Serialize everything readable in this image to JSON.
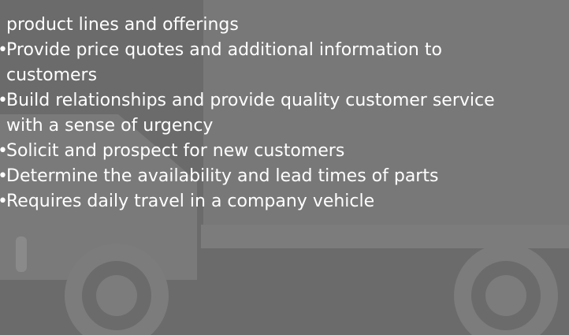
{
  "bullets": [
    {
      "lines": [
        "product lines and offerings"
      ],
      "continuation": true
    },
    {
      "lines": [
        "Provide price quotes and additional information to",
        "customers"
      ]
    },
    {
      "lines": [
        "Build relationships and provide quality customer service",
        "with a sense of urgency"
      ]
    },
    {
      "lines": [
        "Solicit and prospect for new customers"
      ]
    },
    {
      "lines": [
        "Determine the availability and lead times of parts"
      ]
    },
    {
      "lines": [
        "Requires daily travel in a company vehicle"
      ]
    }
  ],
  "bullet_glyph": "•",
  "icon": "truck-icon",
  "colors": {
    "background": "#6b6b6b",
    "truck": "#7b7b7b",
    "text": "#ffffff"
  }
}
